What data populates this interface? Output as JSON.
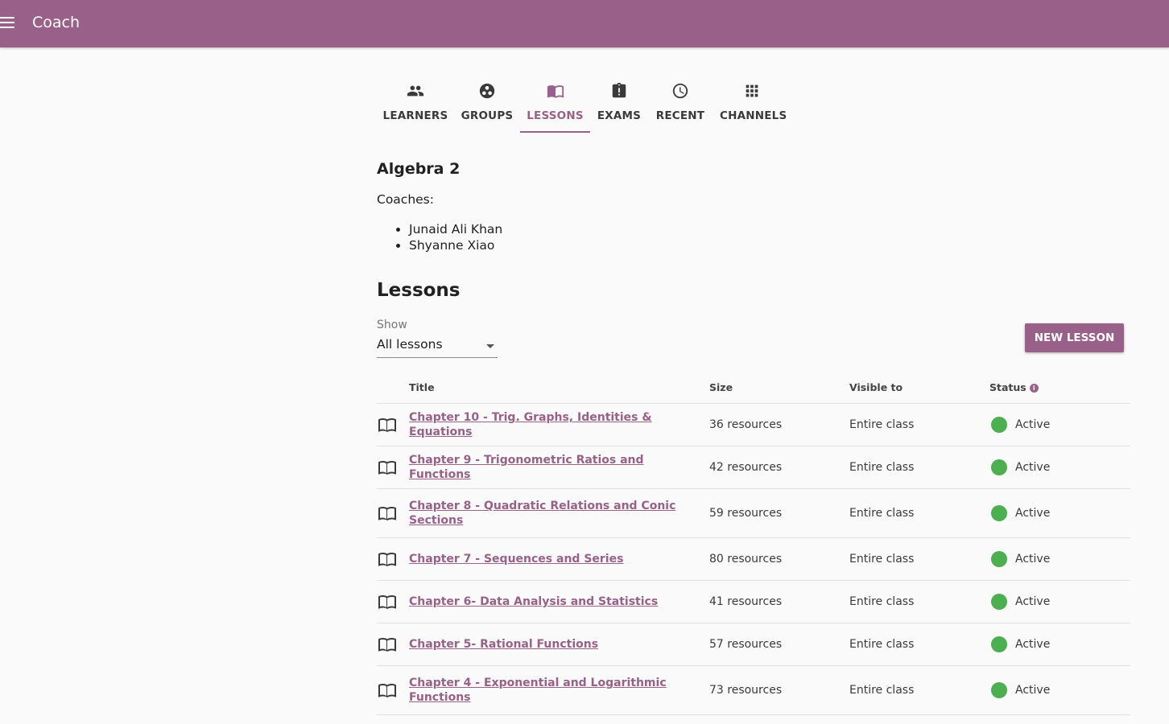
{
  "app": {
    "title": "Coach"
  },
  "tabs": [
    {
      "label": "LEARNERS",
      "icon": "people-icon",
      "active": false
    },
    {
      "label": "GROUPS",
      "icon": "groups-icon",
      "active": false
    },
    {
      "label": "LESSONS",
      "icon": "book-icon",
      "active": true
    },
    {
      "label": "EXAMS",
      "icon": "clipboard-alert-icon",
      "active": false
    },
    {
      "label": "RECENT",
      "icon": "clock-icon",
      "active": false
    },
    {
      "label": "CHANNELS",
      "icon": "grid-icon",
      "active": false
    }
  ],
  "class": {
    "name": "Algebra 2",
    "coaches_label": "Coaches:",
    "coaches": [
      "Junaid Ali Khan",
      "Shyanne Xiao"
    ]
  },
  "lessons": {
    "heading": "Lessons",
    "filter": {
      "label": "Show",
      "value": "All lessons"
    },
    "new_button": "NEW LESSON",
    "columns": {
      "title": "Title",
      "size": "Size",
      "visible_to": "Visible to",
      "status": "Status"
    },
    "rows": [
      {
        "title": "Chapter 10 - Trig. Graphs, Identities & Equations",
        "size": "36 resources",
        "visible_to": "Entire class",
        "status": "Active"
      },
      {
        "title": "Chapter 9 - Trigonometric Ratios and Functions",
        "size": "42 resources",
        "visible_to": "Entire class",
        "status": "Active"
      },
      {
        "title": "Chapter 8 - Quadratic Relations and Conic Sections",
        "size": "59 resources",
        "visible_to": "Entire class",
        "status": "Active"
      },
      {
        "title": "Chapter 7 - Sequences and Series",
        "size": "80 resources",
        "visible_to": "Entire class",
        "status": "Active"
      },
      {
        "title": "Chapter 6- Data Analysis and Statistics",
        "size": "41 resources",
        "visible_to": "Entire class",
        "status": "Active"
      },
      {
        "title": "Chapter 5- Rational Functions",
        "size": "57 resources",
        "visible_to": "Entire class",
        "status": "Active"
      },
      {
        "title": "Chapter 4 - Exponential and Logarithmic Functions",
        "size": "73 resources",
        "visible_to": "Entire class",
        "status": "Active"
      }
    ]
  },
  "colors": {
    "brand": "#996189",
    "active_status": "#4caf50"
  }
}
